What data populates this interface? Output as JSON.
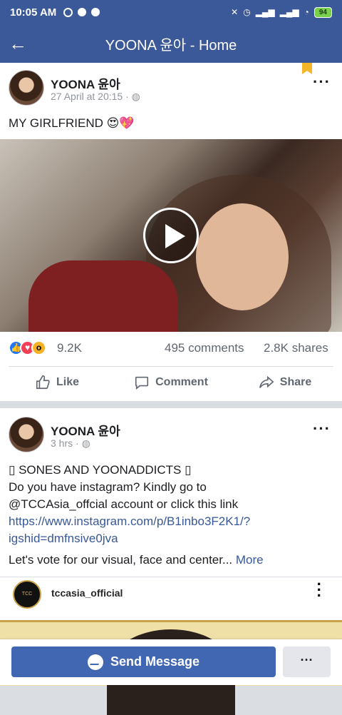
{
  "status_bar": {
    "time": "10:05 AM",
    "battery": "94"
  },
  "app_bar": {
    "title": "YOONA 윤아 - Home"
  },
  "post1": {
    "author": "YOONA 윤아",
    "timestamp": "27 April at 20:15 · ",
    "text": "MY GIRLFRIEND 😍💖",
    "reactions_count": "9.2K",
    "comments": "495 comments",
    "shares": "2.8K shares",
    "actions": {
      "like": "Like",
      "comment": "Comment",
      "share": "Share"
    }
  },
  "post2": {
    "author": "YOONA 윤아",
    "timestamp": "3 hrs · ",
    "lines": [
      "▯ SONES AND YOONADDICTS ▯",
      "Do you have instagram? Kindly go to",
      "@TCCAsia_offcial account or click this link"
    ],
    "link": "https://www.instagram.com/p/B1inbo3F2K1/?igshid=dmfnsive0jva",
    "link_line1": "https://www.instagram.com/p/B1inbo3F2K1/?",
    "link_line2": "igshid=dmfnsive0jva",
    "last_line": "Let's vote for our visual, face and center... ",
    "see_more": "More",
    "embed_user": "tccasia_official"
  },
  "bottom_bar": {
    "send_message": "Send Message",
    "more": "···"
  },
  "colors": {
    "brand": "#3b5998",
    "button": "#4267b2",
    "link": "#385898"
  }
}
